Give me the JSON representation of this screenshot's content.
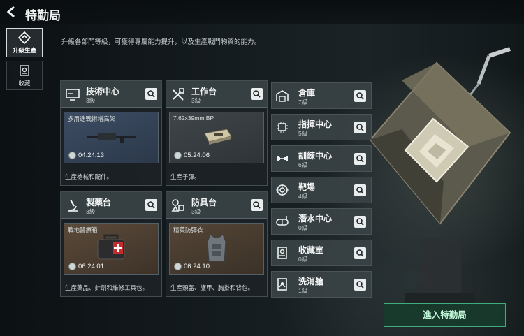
{
  "header": {
    "title": "特勤局"
  },
  "description": "升級各部門等級，可獲得專屬能力提升，以及生產戰鬥物資的能力。",
  "nav": [
    {
      "label": "升級生產",
      "active": true
    },
    {
      "label": "收藏",
      "active": false
    }
  ],
  "cards": [
    {
      "name": "技術中心",
      "level": "3級",
      "product": "多用途戰術增高架",
      "timer": "04:24:13",
      "footer": "生產槍械和配件。"
    },
    {
      "name": "工作台",
      "level": "3級",
      "product": "7.62x39mm BP",
      "timer": "05:24:06",
      "footer": "生產子彈。"
    },
    {
      "name": "製藥台",
      "level": "3級",
      "product": "戰地醫療箱",
      "timer": "06:24:01",
      "footer": "生產藥品、針劑和維修工具包。"
    },
    {
      "name": "防具台",
      "level": "3級",
      "product": "精英防彈衣",
      "timer": "06:24:10",
      "footer": "生產頭盔、護甲、胸掛和背包。"
    }
  ],
  "facilities": [
    {
      "name": "倉庫",
      "level": "7級"
    },
    {
      "name": "指揮中心",
      "level": "5級"
    },
    {
      "name": "訓練中心",
      "level": "6級"
    },
    {
      "name": "靶場",
      "level": "4級"
    },
    {
      "name": "潛水中心",
      "level": "0級"
    },
    {
      "name": "收藏室",
      "level": "0級"
    },
    {
      "name": "洗消艙",
      "level": "1級"
    }
  ],
  "enter_button": "進入特勤局",
  "colors": {
    "accent": "#3fae7c",
    "panel": "#3a4245",
    "text": "#e8ecec"
  }
}
